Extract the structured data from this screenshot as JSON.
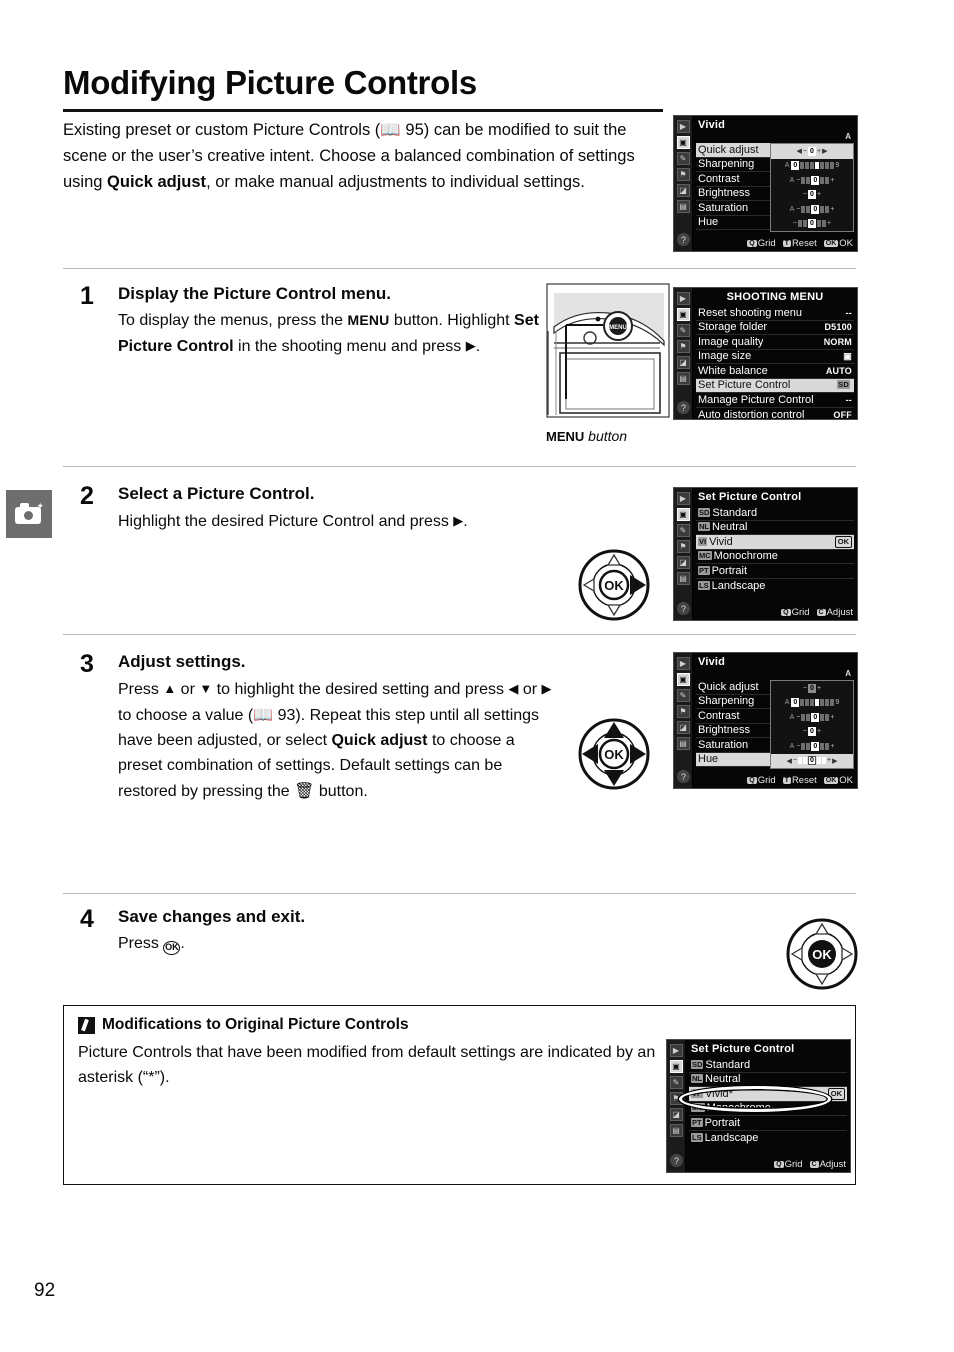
{
  "page": {
    "title": "Modifying Picture Controls",
    "number": "92",
    "margin_tab_icon": "camera-icon"
  },
  "intro": {
    "line1": "Existing preset or custom Picture Controls (",
    "ref_icon": "book-icon",
    "ref_page": "95",
    "line2": ") can be modified to suit the scene or the user’s creative intent.  Choose a balanced combination of settings using ",
    "bold": "Quick adjust",
    "line3": ", or make manual adjustments to individual settings."
  },
  "steps": [
    {
      "num": "1",
      "heading": "Display the Picture Control menu.",
      "body_a": "To display the menus, press the ",
      "menu_word": "MENU",
      "body_b": " button. Highlight ",
      "bold": "Set Picture Control",
      "body_c": " in the shooting menu and press ",
      "arrow": "▶",
      "body_d": "."
    },
    {
      "num": "2",
      "heading": "Select a Picture Control.",
      "body_a": "Highlight the desired Picture Control and press ",
      "arrow": "▶",
      "body_d": "."
    },
    {
      "num": "3",
      "heading": "Adjust settings.",
      "body_a": "Press ",
      "up": "▲",
      "body_b": " or ",
      "down": "▼",
      "body_c": " to highlight the desired setting and press ",
      "left": "◀",
      "body_d": " or ",
      "right": "▶",
      "body_e": " to choose a value (",
      "ref_icon": "book-icon",
      "ref_page": "93",
      "body_f": ").  Repeat this step until all settings have been adjusted, or select ",
      "bold": "Quick adjust",
      "body_g": " to choose a preset combination of settings.  Default settings can be restored by pressing the ",
      "trash_icon": "trash-icon",
      "body_h": " button."
    },
    {
      "num": "4",
      "heading": "Save changes and exit.",
      "body_a": "Press ",
      "ok_icon": "ok-button-icon",
      "body_b": "."
    }
  ],
  "camera_illustration": {
    "caption_bold": "MENU",
    "caption_italic": " button",
    "button_label": "MENU"
  },
  "lcd_vivid_top": {
    "title": "Vivid",
    "auto_indicator": "A",
    "rows": [
      {
        "label": "Quick adjust",
        "highlighted": true,
        "meter": "quick",
        "value": "0"
      },
      {
        "label": "Sharpening",
        "highlighted": false,
        "meter": "sharpening",
        "value": "0"
      },
      {
        "label": "Contrast",
        "highlighted": false,
        "meter": "plusminus",
        "value": "0"
      },
      {
        "label": "Brightness",
        "highlighted": false,
        "meter": "short",
        "value": "0"
      },
      {
        "label": "Saturation",
        "highlighted": false,
        "meter": "plusminus",
        "value": "0"
      },
      {
        "label": "Hue",
        "highlighted": false,
        "meter": "plusminus",
        "value": "0"
      }
    ],
    "footer": [
      {
        "key": "Q",
        "label": "Grid"
      },
      {
        "key": "T",
        "label": "Reset"
      },
      {
        "key": "OK",
        "label": "OK"
      }
    ],
    "sidebar_icons": [
      "playback-icon",
      "shooting-menu-icon",
      "custom-settings-icon",
      "setup-menu-icon",
      "retouch-icon",
      "recent-settings-icon"
    ],
    "help_icon": "question-mark-icon"
  },
  "lcd_shooting_menu": {
    "title": "SHOOTING MENU",
    "rows": [
      {
        "label": "Reset shooting menu",
        "value": "--",
        "highlighted": false
      },
      {
        "label": "Storage folder",
        "value": "D5100",
        "highlighted": false
      },
      {
        "label": "Image quality",
        "value": "NORM",
        "highlighted": false
      },
      {
        "label": "Image size",
        "value": "▣",
        "highlighted": false
      },
      {
        "label": "White balance",
        "value": "AUTO",
        "highlighted": false
      },
      {
        "label": "Set Picture Control",
        "value": "SD",
        "highlighted": true
      },
      {
        "label": "Manage Picture Control",
        "value": "--",
        "highlighted": false
      },
      {
        "label": "Auto distortion control",
        "value": "OFF",
        "highlighted": false
      }
    ]
  },
  "lcd_set_picture_control": {
    "title": "Set Picture Control",
    "rows": [
      {
        "tag": "SD",
        "label": "Standard",
        "highlighted": false,
        "ok": false
      },
      {
        "tag": "NL",
        "label": "Neutral",
        "highlighted": false,
        "ok": false
      },
      {
        "tag": "VI",
        "label": "Vivid",
        "highlighted": true,
        "ok": true
      },
      {
        "tag": "MC",
        "label": "Monochrome",
        "highlighted": false,
        "ok": false
      },
      {
        "tag": "PT",
        "label": "Portrait",
        "highlighted": false,
        "ok": false
      },
      {
        "tag": "LS",
        "label": "Landscape",
        "highlighted": false,
        "ok": false
      }
    ],
    "footer": [
      {
        "key": "Q",
        "label": "Grid"
      },
      {
        "key": "C",
        "label": "Adjust"
      }
    ]
  },
  "lcd_vivid_adjust": {
    "title": "Vivid",
    "auto_indicator": "A",
    "rows": [
      {
        "label": "Quick adjust",
        "highlighted": false,
        "meter": "quickdim",
        "value": "0"
      },
      {
        "label": "Sharpening",
        "highlighted": false,
        "meter": "sharpening",
        "value": "0"
      },
      {
        "label": "Contrast",
        "highlighted": false,
        "meter": "plusminus",
        "value": "0"
      },
      {
        "label": "Brightness",
        "highlighted": false,
        "meter": "short",
        "value": "0"
      },
      {
        "label": "Saturation",
        "highlighted": false,
        "meter": "plusminus",
        "value": "0"
      },
      {
        "label": "Hue",
        "highlighted": true,
        "meter": "hue",
        "value": "0"
      }
    ],
    "footer": [
      {
        "key": "Q",
        "label": "Grid"
      },
      {
        "key": "T",
        "label": "Reset"
      },
      {
        "key": "OK",
        "label": "OK"
      }
    ]
  },
  "lcd_note_screen": {
    "title": "Set Picture Control",
    "rows": [
      {
        "tag": "SD",
        "label": "Standard",
        "highlighted": false,
        "ok": false
      },
      {
        "tag": "NL",
        "label": "Neutral",
        "highlighted": false,
        "ok": false
      },
      {
        "tag": "VI*",
        "label": "Vivid*",
        "highlighted": true,
        "ok": true
      },
      {
        "tag": "MC",
        "label": "Monochrome",
        "highlighted": false,
        "ok": false
      },
      {
        "tag": "PT",
        "label": "Portrait",
        "highlighted": false,
        "ok": false
      },
      {
        "tag": "LS",
        "label": "Landscape",
        "highlighted": false,
        "ok": false
      }
    ],
    "footer": [
      {
        "key": "Q",
        "label": "Grid"
      },
      {
        "key": "C",
        "label": "Adjust"
      }
    ],
    "callout": "ellipse-highlight"
  },
  "note": {
    "icon": "pencil-icon",
    "title": "Modifications to Original Picture Controls",
    "body": "Picture Controls that have been modified from default settings are indicated by an asterisk (“*”)."
  },
  "multiselector": {
    "center_label": "OK"
  },
  "colors": {
    "lcd_background": "#060606",
    "lcd_highlight": "#d9d9d9",
    "margin_tab": "#6e6e6e",
    "rule": "#b9b9b9"
  }
}
